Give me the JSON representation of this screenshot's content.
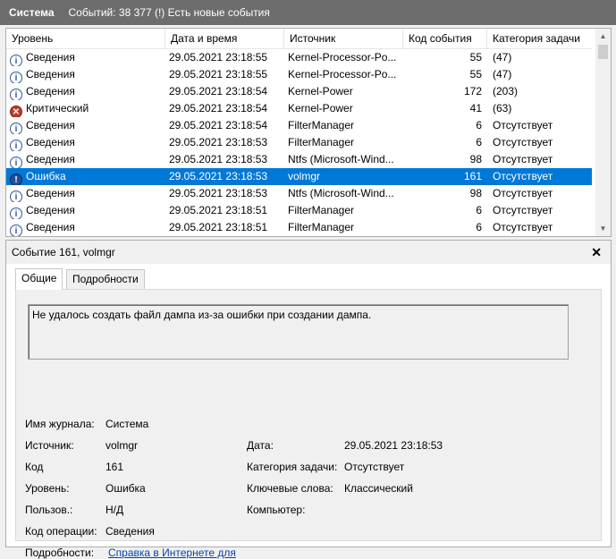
{
  "header": {
    "title": "Система",
    "events_text": "Событий: 38 377 (!) Есть новые события"
  },
  "columns": {
    "level": "Уровень",
    "date": "Дата и время",
    "source": "Источник",
    "event_id": "Код события",
    "category": "Категория задачи"
  },
  "rows": [
    {
      "icon": "info-icon",
      "level": "Сведения",
      "date": "29.05.2021 23:18:55",
      "source": "Kernel-Processor-Po...",
      "event_id": "55",
      "category": "(47)"
    },
    {
      "icon": "info-icon",
      "level": "Сведения",
      "date": "29.05.2021 23:18:55",
      "source": "Kernel-Processor-Po...",
      "event_id": "55",
      "category": "(47)"
    },
    {
      "icon": "info-icon",
      "level": "Сведения",
      "date": "29.05.2021 23:18:54",
      "source": "Kernel-Power",
      "event_id": "172",
      "category": "(203)"
    },
    {
      "icon": "critical-icon",
      "level": "Критический",
      "date": "29.05.2021 23:18:54",
      "source": "Kernel-Power",
      "event_id": "41",
      "category": "(63)"
    },
    {
      "icon": "info-icon",
      "level": "Сведения",
      "date": "29.05.2021 23:18:54",
      "source": "FilterManager",
      "event_id": "6",
      "category": "Отсутствует"
    },
    {
      "icon": "info-icon",
      "level": "Сведения",
      "date": "29.05.2021 23:18:53",
      "source": "FilterManager",
      "event_id": "6",
      "category": "Отсутствует"
    },
    {
      "icon": "info-icon",
      "level": "Сведения",
      "date": "29.05.2021 23:18:53",
      "source": "Ntfs (Microsoft-Wind...",
      "event_id": "98",
      "category": "Отсутствует"
    },
    {
      "icon": "error-icon",
      "level": "Ошибка",
      "date": "29.05.2021 23:18:53",
      "source": "volmgr",
      "event_id": "161",
      "category": "Отсутствует",
      "selected": true
    },
    {
      "icon": "info-icon",
      "level": "Сведения",
      "date": "29.05.2021 23:18:53",
      "source": "Ntfs (Microsoft-Wind...",
      "event_id": "98",
      "category": "Отсутствует"
    },
    {
      "icon": "info-icon",
      "level": "Сведения",
      "date": "29.05.2021 23:18:51",
      "source": "FilterManager",
      "event_id": "6",
      "category": "Отсутствует"
    },
    {
      "icon": "info-icon",
      "level": "Сведения",
      "date": "29.05.2021 23:18:51",
      "source": "FilterManager",
      "event_id": "6",
      "category": "Отсутствует"
    }
  ],
  "detail": {
    "title": "Событие 161, volmgr",
    "close_glyph": "✕",
    "tabs": [
      "Общие",
      "Подробности"
    ],
    "message": "Не удалось создать файл дампа из-за ошибки при создании дампа.",
    "fields": {
      "log_name_label": "Имя журнала:",
      "log_name": "Система",
      "source_label": "Источник:",
      "source": "volmgr",
      "date_label": "Дата:",
      "date": "29.05.2021 23:18:53",
      "code_label": "Код",
      "code": "161",
      "category_label": "Категория задачи:",
      "category": "Отсутствует",
      "level_label": "Уровень:",
      "level": "Ошибка",
      "keywords_label": "Ключевые слова:",
      "keywords": "Классический",
      "user_label": "Пользов.:",
      "user": "Н/Д",
      "computer_label": "Компьютер:",
      "computer": "",
      "opcode_label": "Код операции:",
      "opcode": "Сведения",
      "more_label": "Подробности:",
      "more_link": "Справка в Интернете для"
    }
  }
}
